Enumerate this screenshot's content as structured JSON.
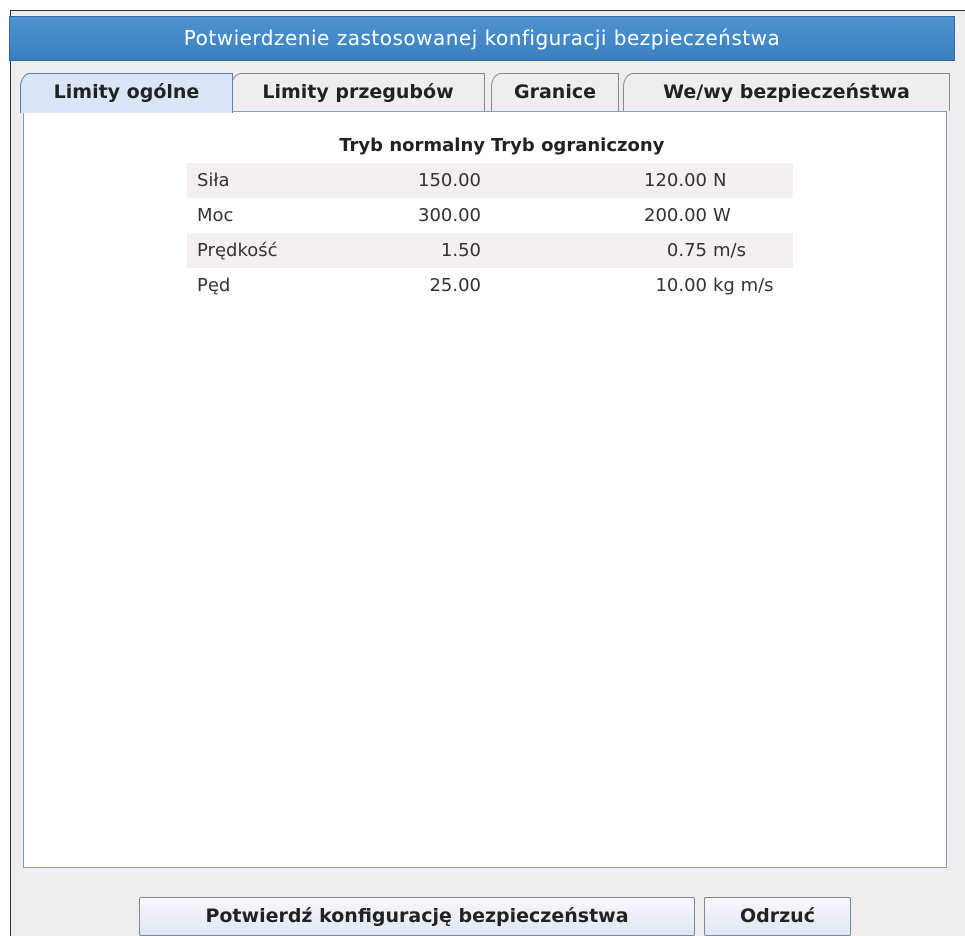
{
  "dialog": {
    "title": "Potwierdzenie zastosowanej konfiguracji bezpieczeństwa"
  },
  "tabs": [
    {
      "label": "Limity ogólne",
      "active": true
    },
    {
      "label": "Limity przegubów",
      "active": false
    },
    {
      "label": "Granice",
      "active": false
    },
    {
      "label": "We/wy bezpieczeństwa",
      "active": false
    }
  ],
  "limits_table": {
    "headers": {
      "normal": "Tryb normalny",
      "reduced": "Tryb ograniczony"
    },
    "rows": [
      {
        "label": "Siła",
        "normal": "150.00",
        "reduced": "120.00",
        "unit": "N"
      },
      {
        "label": "Moc",
        "normal": "300.00",
        "reduced": "200.00",
        "unit": "W"
      },
      {
        "label": "Prędkość",
        "normal": "1.50",
        "reduced": "0.75",
        "unit": "m/s"
      },
      {
        "label": "Pęd",
        "normal": "25.00",
        "reduced": "10.00",
        "unit": "kg m/s"
      }
    ]
  },
  "buttons": {
    "confirm": "Potwierdź konfigurację bezpieczeństwa",
    "reject": "Odrzuć"
  },
  "colors": {
    "titlebar": "#4588c8",
    "active_tab": "#d9e6f7",
    "row_shade": "#f4eff1"
  }
}
